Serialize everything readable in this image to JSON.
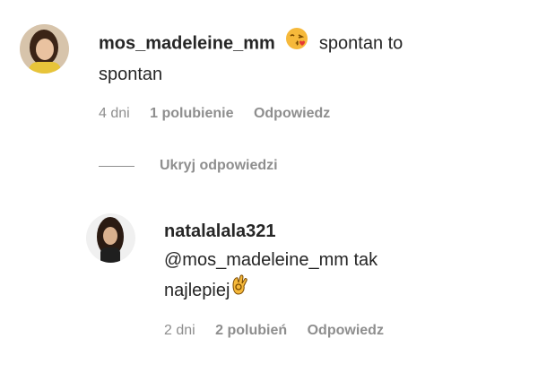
{
  "comments": [
    {
      "username": "mos_madeleine_mm",
      "emoji": "kiss-face-icon",
      "text_line1": "spontan to",
      "text_line2": "spontan",
      "time": "4 dni",
      "likes": "1 polubienie",
      "reply": "Odpowiedz"
    },
    {
      "username": "natalalala321",
      "mention": "@mos_madeleine_mm",
      "text_line1_rest": "tak",
      "text_line2": "najlepiej",
      "emoji": "ok-hand-icon",
      "time": "2 dni",
      "likes": "2 polubień",
      "reply": "Odpowiedz"
    }
  ],
  "replies_toggle": "Ukryj odpowiedzi",
  "colors": {
    "text": "#262626",
    "secondary": "#8e8e8e"
  }
}
